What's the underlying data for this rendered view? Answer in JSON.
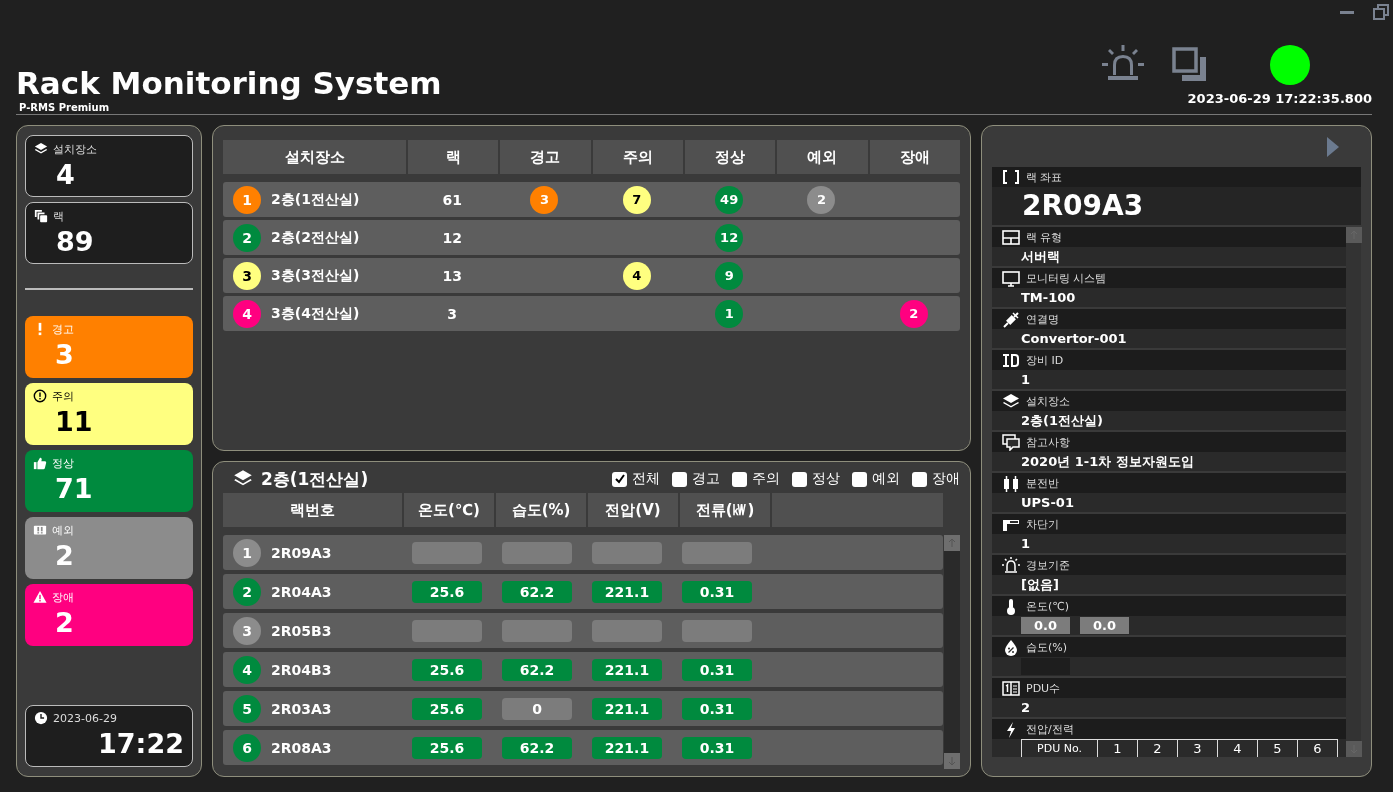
{
  "header": {
    "title": "Rack Monitoring System",
    "subtitle": "P-RMS Premium",
    "datetime": "2023-06-29 17:22:35.800",
    "connected": true
  },
  "summary": {
    "totals": [
      {
        "label": "설치장소",
        "value": "4"
      },
      {
        "label": "랙",
        "value": "89"
      }
    ],
    "statuses": [
      {
        "label": "경고",
        "value": "3",
        "color": "#ff8000"
      },
      {
        "label": "주의",
        "value": "11",
        "color": "#ffff80"
      },
      {
        "label": "정상",
        "value": "71",
        "color": "#008a3e"
      },
      {
        "label": "예외",
        "value": "2",
        "color": "#8c8c8c"
      },
      {
        "label": "장애",
        "value": "2",
        "color": "#ff0080"
      }
    ],
    "clock": {
      "date": "2023-06-29",
      "time": "17:22"
    }
  },
  "locations": {
    "columns": [
      "설치장소",
      "랙",
      "경고",
      "주의",
      "정상",
      "예외",
      "장애"
    ],
    "rows": [
      {
        "no": "1",
        "color": "#ff8000",
        "name": "2층(1전산실)",
        "racks": "61",
        "counts": {
          "warning": "3",
          "caution": "7",
          "normal": "49",
          "exception": "2"
        }
      },
      {
        "no": "2",
        "color": "#008a3e",
        "name": "2층(2전산실)",
        "racks": "12",
        "counts": {
          "normal": "12"
        }
      },
      {
        "no": "3",
        "color": "#ffff80",
        "name": "3층(3전산실)",
        "racks": "13",
        "counts": {
          "caution": "4",
          "normal": "9"
        }
      },
      {
        "no": "4",
        "color": "#ff0080",
        "name": "3층(4전산실)",
        "racks": "3",
        "counts": {
          "normal": "1",
          "fault": "2"
        }
      }
    ]
  },
  "racks": {
    "title": "2층(1전산실)",
    "filters": [
      {
        "label": "전체",
        "checked": true
      },
      {
        "label": "경고",
        "checked": false
      },
      {
        "label": "주의",
        "checked": false
      },
      {
        "label": "정상",
        "checked": false
      },
      {
        "label": "예외",
        "checked": false
      },
      {
        "label": "장애",
        "checked": false
      }
    ],
    "columns": [
      "랙번호",
      "온도(℃)",
      "습도(%)",
      "전압(V)",
      "전류(㎾)"
    ],
    "rows": [
      {
        "no": "1",
        "color": "#8c8c8c",
        "rack": "2R09A3",
        "readings": [
          {
            "normal": false
          },
          {
            "normal": false
          },
          {
            "normal": false
          },
          {
            "normal": false
          }
        ]
      },
      {
        "no": "2",
        "color": "#008a3e",
        "rack": "2R04A3",
        "readings": [
          {
            "value": "25.6",
            "normal": true
          },
          {
            "value": "62.2",
            "normal": true
          },
          {
            "value": "221.1",
            "normal": true
          },
          {
            "value": "0.31",
            "normal": true
          }
        ]
      },
      {
        "no": "3",
        "color": "#8c8c8c",
        "rack": "2R05B3",
        "readings": [
          {
            "normal": false
          },
          {
            "normal": false
          },
          {
            "normal": false
          },
          {
            "normal": false
          }
        ]
      },
      {
        "no": "4",
        "color": "#008a3e",
        "rack": "2R04B3",
        "readings": [
          {
            "value": "25.6",
            "normal": true
          },
          {
            "value": "62.2",
            "normal": true
          },
          {
            "value": "221.1",
            "normal": true
          },
          {
            "value": "0.31",
            "normal": true
          }
        ]
      },
      {
        "no": "5",
        "color": "#008a3e",
        "rack": "2R03A3",
        "readings": [
          {
            "value": "25.6",
            "normal": true
          },
          {
            "value": "0",
            "normal": false
          },
          {
            "value": "221.1",
            "normal": true
          },
          {
            "value": "0.31",
            "normal": true
          }
        ]
      },
      {
        "no": "6",
        "color": "#008a3e",
        "rack": "2R08A3",
        "readings": [
          {
            "value": "25.6",
            "normal": true
          },
          {
            "value": "62.2",
            "normal": true
          },
          {
            "value": "221.1",
            "normal": true
          },
          {
            "value": "0.31",
            "normal": true
          }
        ]
      }
    ]
  },
  "detail": {
    "coord_label": "랙 좌표",
    "coord": "2R09A3",
    "fields": [
      {
        "kind": "text",
        "label": "랙 유형",
        "value": "서버랙"
      },
      {
        "kind": "text",
        "label": "모니터링 시스템",
        "value": "TM-100"
      },
      {
        "kind": "text",
        "label": "연결명",
        "value": "Convertor-001"
      },
      {
        "kind": "text",
        "label": "장비 ID",
        "value": "1"
      },
      {
        "kind": "text",
        "label": "설치장소",
        "value": "2층(1전산실)"
      },
      {
        "kind": "text",
        "label": "참고사항",
        "value": "2020년 1-1차 정보자원도입"
      },
      {
        "kind": "text",
        "label": "분전반",
        "value": "UPS-01"
      },
      {
        "kind": "text",
        "label": "차단기",
        "value": "1"
      },
      {
        "kind": "text",
        "label": "경보기준",
        "value": "[없음]"
      },
      {
        "kind": "boxes",
        "label": "온도(℃)",
        "values": [
          "0.0",
          "0.0"
        ]
      },
      {
        "kind": "blank",
        "label": "습도(%)"
      },
      {
        "kind": "text",
        "label": "PDU수",
        "value": "2"
      },
      {
        "kind": "table",
        "label": "전압/전력",
        "header": [
          "PDU No.",
          "1",
          "2",
          "3",
          "4",
          "5",
          "6"
        ]
      }
    ]
  }
}
